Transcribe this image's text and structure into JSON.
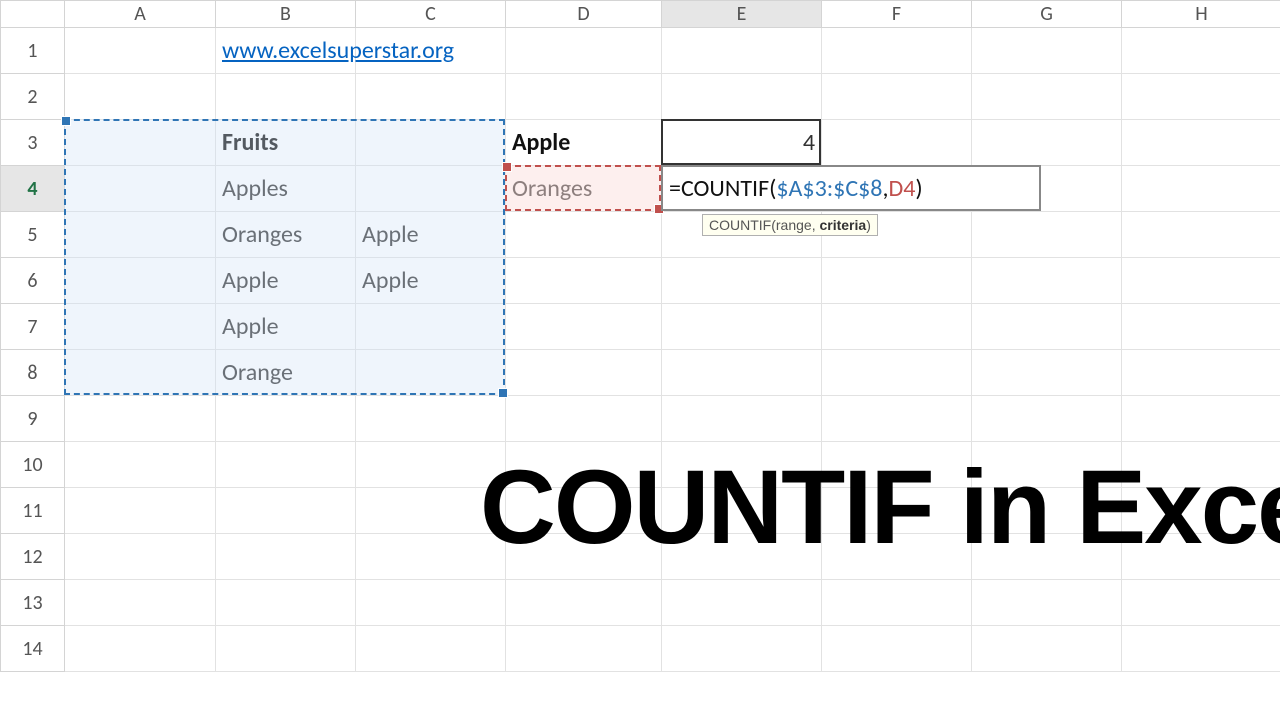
{
  "columns": [
    "",
    "A",
    "B",
    "C",
    "D",
    "E",
    "F",
    "G",
    "H"
  ],
  "rows": [
    "1",
    "2",
    "3",
    "4",
    "5",
    "6",
    "7",
    "8",
    "9",
    "10",
    "11",
    "12",
    "13",
    "14"
  ],
  "active": {
    "col": "E",
    "row": "4"
  },
  "cells": {
    "B1": {
      "text": "www.excelsuperstar.org",
      "class": "link"
    },
    "B3": {
      "text": "Fruits",
      "class": "bold"
    },
    "B4": {
      "text": "Apples"
    },
    "B5": {
      "text": "Oranges"
    },
    "B6": {
      "text": "Apple"
    },
    "B7": {
      "text": "Apple"
    },
    "B8": {
      "text": "Orange"
    },
    "C5": {
      "text": "Apple"
    },
    "C6": {
      "text": "Apple"
    },
    "D3": {
      "text": "Apple",
      "class": "bold"
    },
    "D4": {
      "text": "Oranges"
    },
    "E3": {
      "text": "4",
      "class": "rj"
    }
  },
  "formula": {
    "prefix": "=COUNTIF(",
    "range": "$A$3:$C$8",
    "comma": ",",
    "criteria": "D4",
    "suffix": ")"
  },
  "tooltip": {
    "fn": "COUNTIF(",
    "p1": "range",
    "sep": ", ",
    "p2": "criteria",
    "close": ")"
  },
  "title": "COUNTIF in Excel",
  "chart_data": {
    "type": "table",
    "data": [
      [
        "",
        "A",
        "B",
        "C",
        "D",
        "E"
      ],
      [
        "1",
        "",
        "www.excelsuperstar.org",
        "",
        "",
        ""
      ],
      [
        "2",
        "",
        "",
        "",
        "",
        ""
      ],
      [
        "3",
        "",
        "Fruits",
        "",
        "Apple",
        4
      ],
      [
        "4",
        "",
        "Apples",
        "",
        "Oranges",
        "=COUNTIF($A$3:$C$8,D4)"
      ],
      [
        "5",
        "",
        "Oranges",
        "Apple",
        "",
        ""
      ],
      [
        "6",
        "",
        "Apple",
        "Apple",
        "",
        ""
      ],
      [
        "7",
        "",
        "Apple",
        "",
        "",
        ""
      ],
      [
        "8",
        "",
        "Orange",
        "",
        "",
        ""
      ]
    ]
  }
}
